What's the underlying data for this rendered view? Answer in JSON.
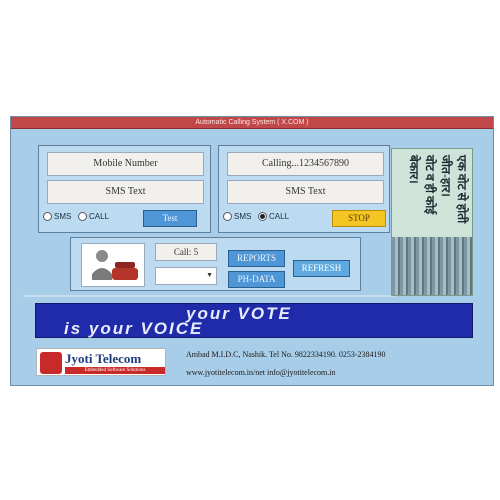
{
  "window": {
    "title": "Automatic Calling System ( X.COM )"
  },
  "left_panel": {
    "mobile_number_label": "Mobile Number",
    "sms_text_label": "SMS Text",
    "radio_sms": "SMS",
    "radio_call": "CALL",
    "test_button": "Test"
  },
  "right_panel": {
    "calling_status": "Calling...1234567890",
    "sms_text_label": "SMS Text",
    "radio_sms": "SMS",
    "radio_call": "CALL",
    "stop_button": "STOP"
  },
  "middle_panel": {
    "call_count": "Call: 5",
    "reports_button": "REPORTS",
    "ph_data_button": "PH-DATA",
    "refresh_button": "REFRESH"
  },
  "hindi_slogan": {
    "line1": "एक वोट से होती जीत-हार।",
    "line2": "वोट व ही कोई बेकार।"
  },
  "banner": {
    "line1": "your VOTE",
    "line2": "is your VOICE"
  },
  "footer": {
    "company_name": "Jyoti Telecom",
    "tagline": "Embedded Software Solutions",
    "address": "Ambad M.I.D.C, Nashik. Tel No. 9822334190. 0253-2384190",
    "contact": "www.jyotitelecom.in/net info@jyotitelecom.in"
  },
  "colors": {
    "window_bg": "#a8cde8",
    "titlebar": "#c04848",
    "button_blue": "#4f96d6",
    "button_yellow": "#f3c623",
    "banner_bg": "#1f2ba8"
  }
}
